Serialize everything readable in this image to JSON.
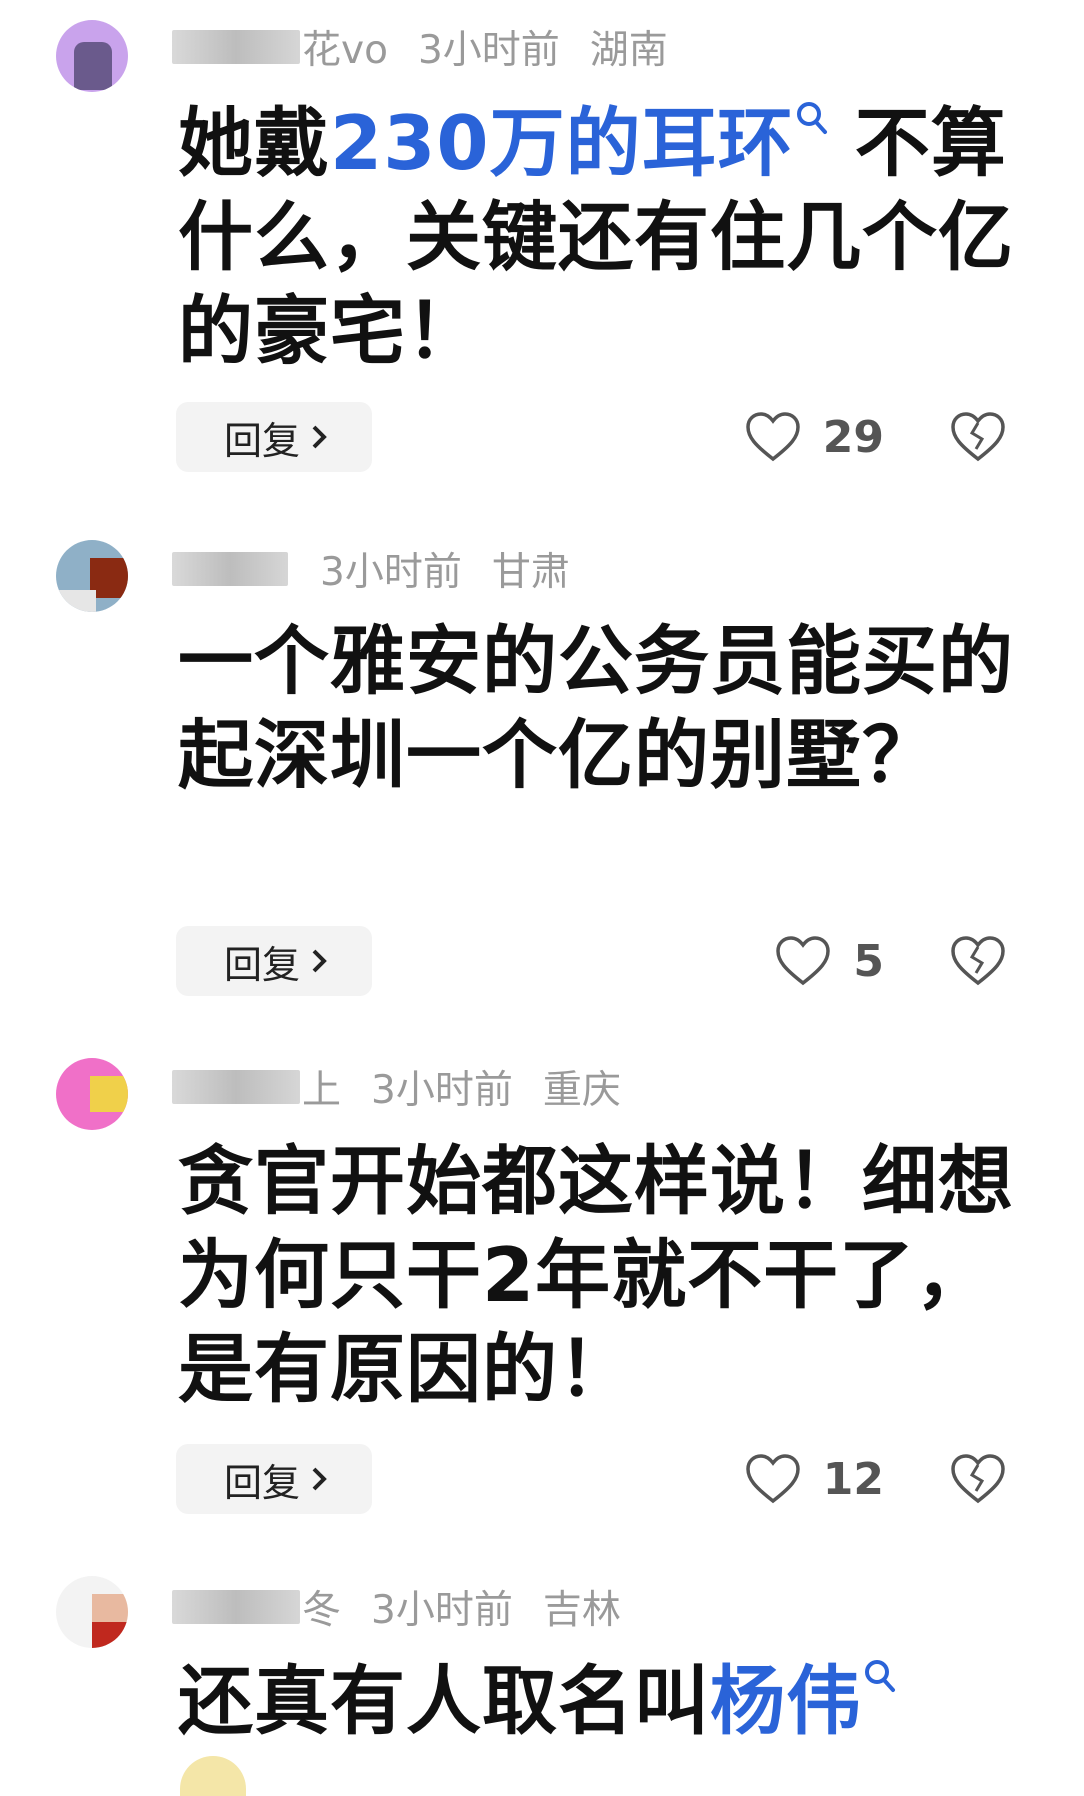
{
  "comments": [
    {
      "nick_suffix": "花vo",
      "time": "3小时前",
      "location": "湖南",
      "text_a": "她戴",
      "text_link": "230万的耳环",
      "text_b": " 不算什么，关键还有住几个亿的豪宅！",
      "reply_label": "回复",
      "likes": "29",
      "avatar_colors": [
        "#c9a3ec",
        "#6a5a8c"
      ]
    },
    {
      "nick_suffix": "",
      "time": "3小时前",
      "location": "甘肃",
      "text_a": "一个雅安的公务员能买的起深圳一个亿的别墅？",
      "text_link": "",
      "text_b": "",
      "reply_label": "回复",
      "likes": "5",
      "avatar_colors": [
        "#8fb0c7",
        "#8a2a12"
      ]
    },
    {
      "nick_suffix": "上",
      "time": "3小时前",
      "location": "重庆",
      "text_a": "贪官开始都这样说！细想为何只干2年就不干了，是有原因的！",
      "text_link": "",
      "text_b": "",
      "reply_label": "回复",
      "likes": "12",
      "avatar_colors": [
        "#f070c8",
        "#f0d04a"
      ]
    },
    {
      "nick_suffix": "冬",
      "time": "3小时前",
      "location": "吉林",
      "text_a": "还真有人取名叫",
      "text_link": "杨伟",
      "text_b": "",
      "avatar_colors": [
        "#e8b9a0",
        "#c0281e"
      ]
    }
  ],
  "colors": {
    "link": "#2a63d8",
    "meta": "#9a9a9a",
    "text": "#111111"
  },
  "icons": {
    "like": "heart-outline-icon",
    "dislike": "broken-heart-icon",
    "search": "search-icon",
    "reply_arrow": "chevron-right-icon"
  }
}
